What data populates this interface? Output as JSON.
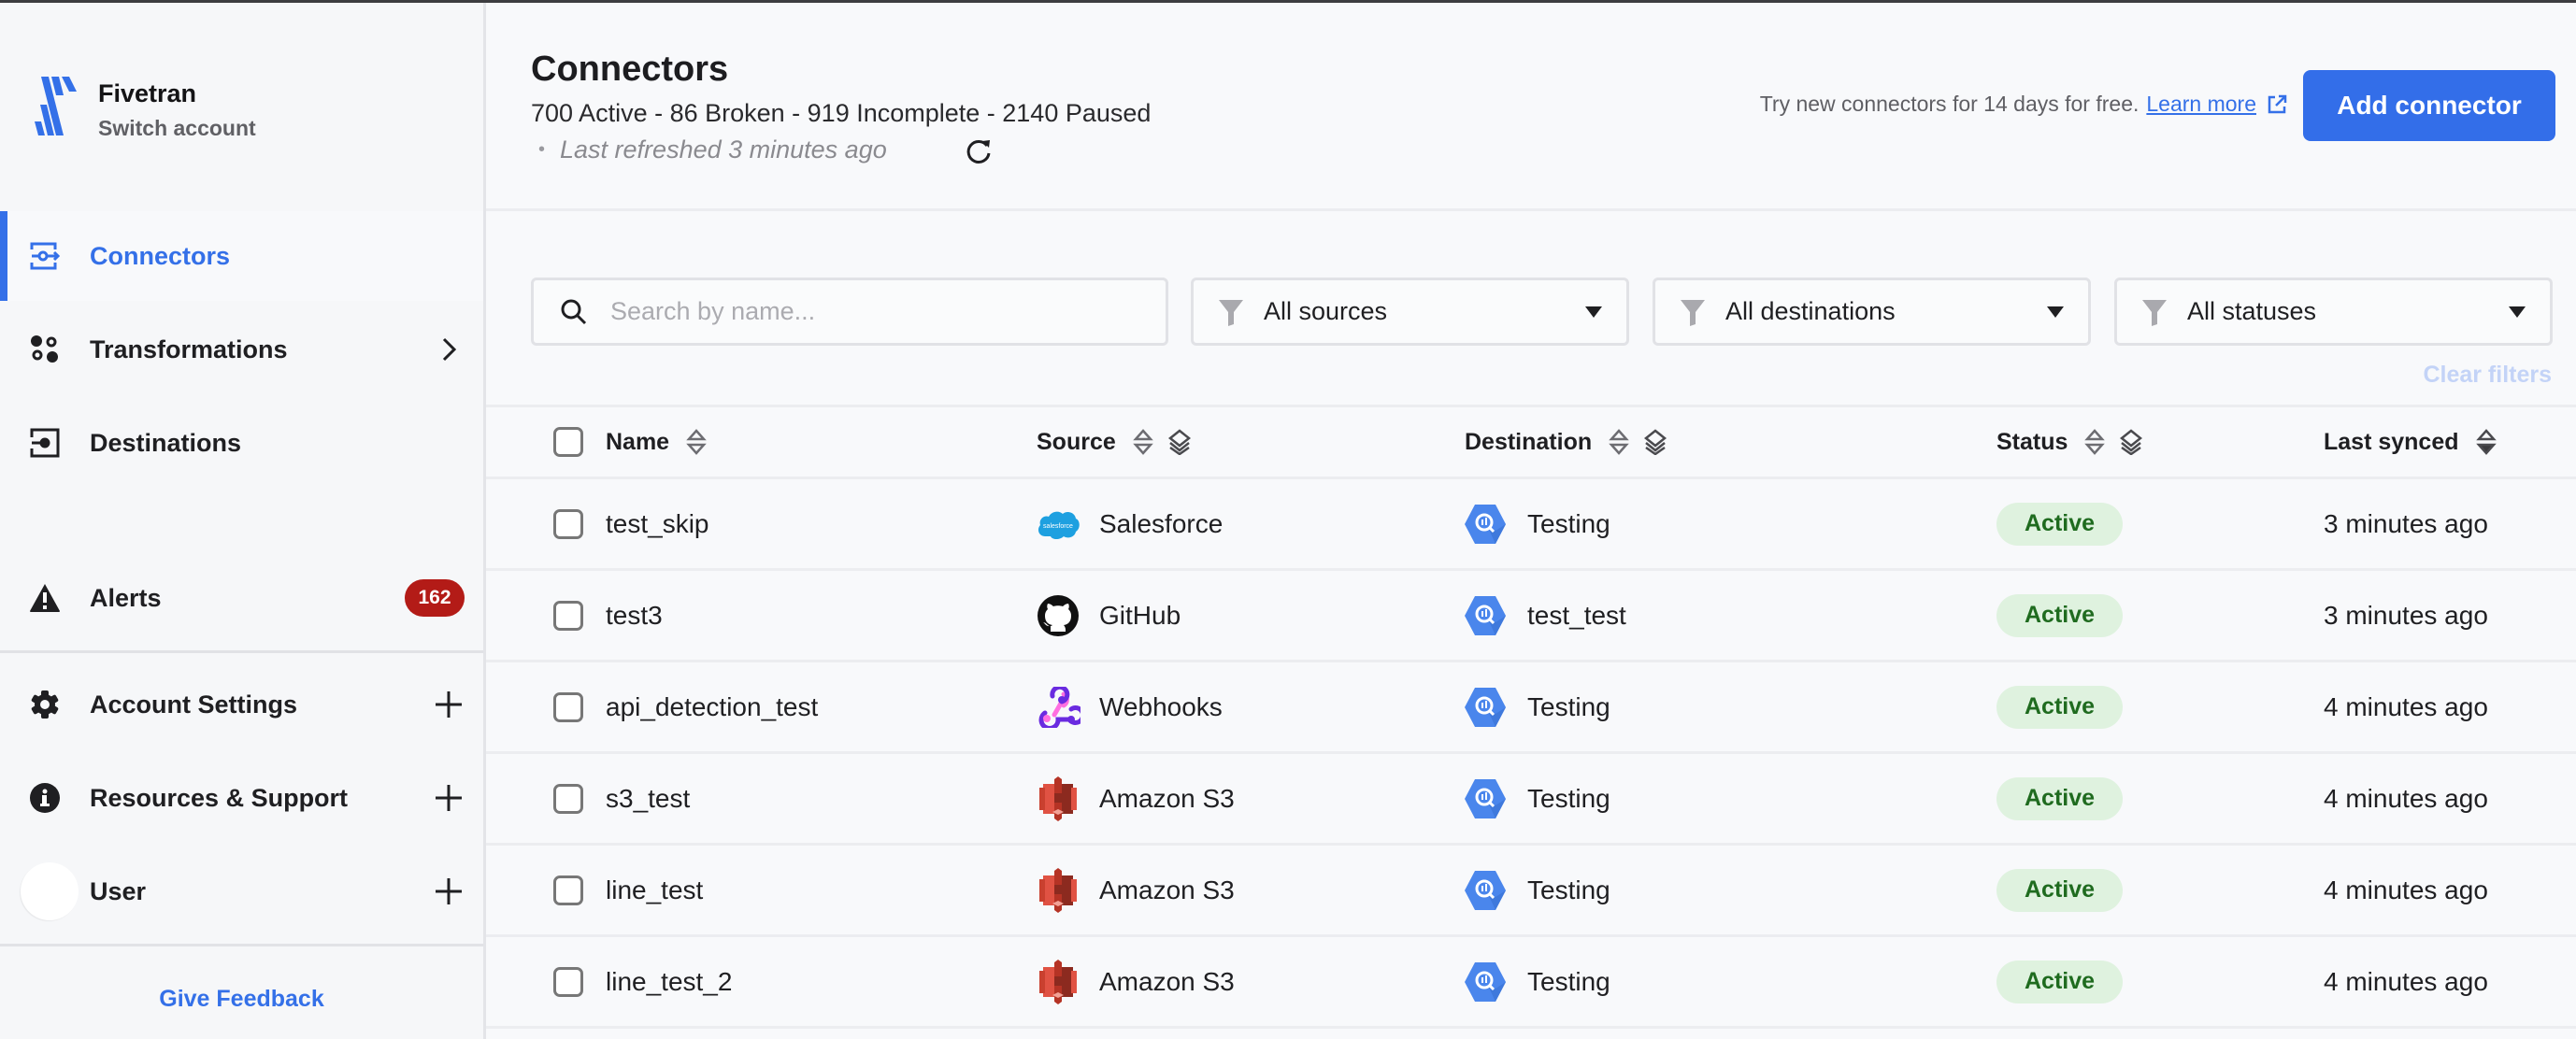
{
  "account": {
    "name": "Fivetran",
    "switch_label": "Switch account"
  },
  "sidebar": {
    "nav": [
      {
        "label": "Connectors",
        "icon": "connector-icon",
        "active": true
      },
      {
        "label": "Transformations",
        "icon": "transformations-icon",
        "trailing": "chevron-right-icon"
      },
      {
        "label": "Destinations",
        "icon": "destination-icon"
      }
    ],
    "alerts": {
      "label": "Alerts",
      "icon": "warning-icon",
      "count": "162"
    },
    "sections": [
      {
        "label": "Account Settings",
        "icon": "gear-icon"
      },
      {
        "label": "Resources & Support",
        "icon": "info-icon"
      },
      {
        "label": "User",
        "icon": "avatar"
      }
    ],
    "feedback_label": "Give Feedback"
  },
  "header": {
    "title": "Connectors",
    "stats": "700 Active - 86 Broken - 919 Incomplete - 2140 Paused",
    "refreshed": "Last refreshed 3 minutes ago",
    "promo_text": "Try new connectors for 14 days for free.",
    "promo_link": "Learn more",
    "add_button": "Add connector"
  },
  "filters": {
    "search_placeholder": "Search by name...",
    "search_value": "",
    "sources": "All sources",
    "destinations": "All destinations",
    "statuses": "All statuses",
    "clear_label": "Clear filters"
  },
  "table": {
    "columns": {
      "name": "Name",
      "source": "Source",
      "destination": "Destination",
      "status": "Status",
      "last_synced": "Last synced"
    },
    "sort": {
      "column": "last_synced",
      "direction": "desc"
    },
    "rows": [
      {
        "name": "test_skip",
        "source": "Salesforce",
        "source_icon": "salesforce",
        "destination": "Testing",
        "status": "Active",
        "last_synced": "3 minutes ago"
      },
      {
        "name": "test3",
        "source": "GitHub",
        "source_icon": "github",
        "destination": "test_test",
        "status": "Active",
        "last_synced": "3 minutes ago"
      },
      {
        "name": "api_detection_test",
        "source": "Webhooks",
        "source_icon": "webhooks",
        "destination": "Testing",
        "status": "Active",
        "last_synced": "4 minutes ago"
      },
      {
        "name": "s3_test",
        "source": "Amazon S3",
        "source_icon": "s3",
        "destination": "Testing",
        "status": "Active",
        "last_synced": "4 minutes ago"
      },
      {
        "name": "line_test",
        "source": "Amazon S3",
        "source_icon": "s3",
        "destination": "Testing",
        "status": "Active",
        "last_synced": "4 minutes ago"
      },
      {
        "name": "line_test_2",
        "source": "Amazon S3",
        "source_icon": "s3",
        "destination": "Testing",
        "status": "Active",
        "last_synced": "4 minutes ago"
      }
    ]
  },
  "colors": {
    "accent": "#3470e8",
    "alert_badge": "#b31b17",
    "status_active_bg": "#dff2df",
    "status_active_text": "#1f6b1f"
  }
}
